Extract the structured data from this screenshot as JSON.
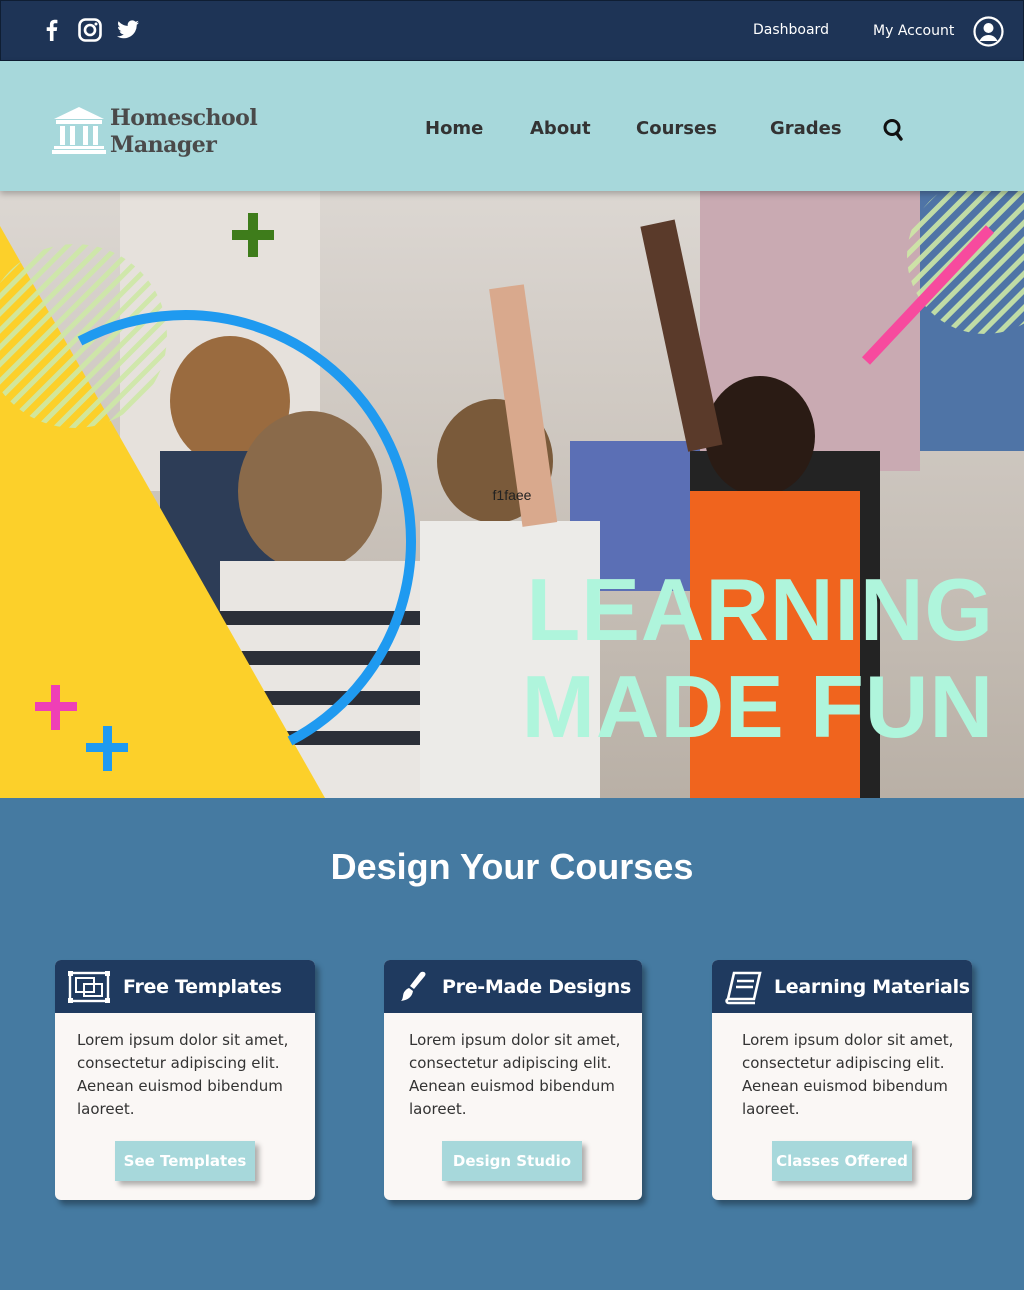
{
  "topbar": {
    "social": [
      "facebook-icon",
      "instagram-icon",
      "twitter-icon"
    ],
    "dashboard_label": "Dashboard",
    "account_label": "My Account"
  },
  "header": {
    "logo_line1": "Homeschool",
    "logo_line2": "Manager",
    "nav": [
      "Home",
      "About",
      "Courses",
      "Grades"
    ]
  },
  "hero": {
    "caption": "f1faee",
    "title_line1": "LEARNING",
    "title_line2": "MADE FUN"
  },
  "section": {
    "title": "Design Your Courses"
  },
  "cards": [
    {
      "title": "Free Templates",
      "icon": "template-icon",
      "text": "Lorem ipsum dolor sit amet, consectetur adipiscing elit. Aenean euismod bibendum laoreet.",
      "button": "See Templates"
    },
    {
      "title": "Pre-Made Designs",
      "icon": "paintbrush-icon",
      "text": "Lorem ipsum dolor sit amet, consectetur adipiscing elit. Aenean euismod bibendum laoreet.",
      "button": "Design Studio"
    },
    {
      "title": "Learning Materials",
      "icon": "book-icon",
      "text": "Lorem ipsum dolor sit amet, consectetur adipiscing elit. Aenean euismod bibendum laoreet.",
      "button": "Classes Offered"
    }
  ],
  "colors": {
    "topbar": "#1e3456",
    "header": "#a7d8db",
    "page": "#457aa1",
    "card_head": "#1f3a5f",
    "hero_title": "#aff5dc",
    "yellow": "#fcd02a"
  }
}
